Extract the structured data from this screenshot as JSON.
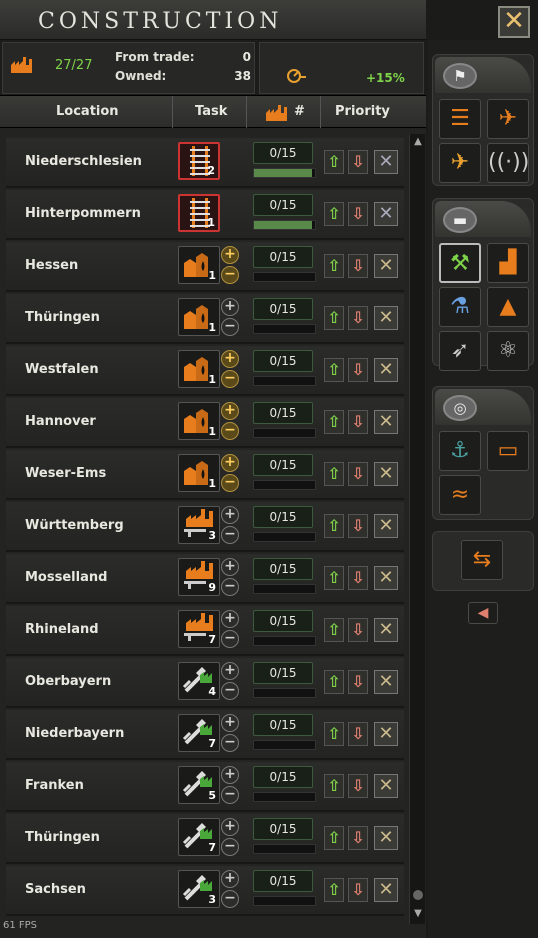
{
  "window": {
    "title": "Construction",
    "close_icon": "close-icon"
  },
  "stats": {
    "factories": "27/27",
    "from_trade_label": "From trade:",
    "from_trade_value": "0",
    "owned_label": "Owned:",
    "owned_value": "38",
    "efficiency": "+15%"
  },
  "columns": {
    "location": "Location",
    "task": "Task",
    "count": "#",
    "priority": "Priority"
  },
  "rows": [
    {
      "name": "Niederschlesien",
      "task": "railway",
      "count": "2",
      "progress": "0/15",
      "fill": 0.95,
      "enabled": true
    },
    {
      "name": "Hinterpommern",
      "task": "railway",
      "count": "1",
      "progress": "0/15",
      "fill": 0.95,
      "enabled": true
    },
    {
      "name": "Hessen",
      "task": "refinery",
      "count": "1",
      "progress": "0/15",
      "fill": 0,
      "enabled": true
    },
    {
      "name": "Thüringen",
      "task": "refinery",
      "count": "1",
      "progress": "0/15",
      "fill": 0,
      "enabled": false
    },
    {
      "name": "Westfalen",
      "task": "refinery",
      "count": "1",
      "progress": "0/15",
      "fill": 0,
      "enabled": true
    },
    {
      "name": "Hannover",
      "task": "refinery",
      "count": "1",
      "progress": "0/15",
      "fill": 0,
      "enabled": true
    },
    {
      "name": "Weser-Ems",
      "task": "refinery",
      "count": "1",
      "progress": "0/15",
      "fill": 0,
      "enabled": true
    },
    {
      "name": "Württemberg",
      "task": "civilian-factory",
      "count": "3",
      "progress": "0/15",
      "fill": 0,
      "enabled": false
    },
    {
      "name": "Mosselland",
      "task": "civilian-factory",
      "count": "9",
      "progress": "0/15",
      "fill": 0,
      "enabled": false
    },
    {
      "name": "Rhineland",
      "task": "civilian-factory",
      "count": "7",
      "progress": "0/15",
      "fill": 0,
      "enabled": false
    },
    {
      "name": "Oberbayern",
      "task": "military-factory",
      "count": "4",
      "progress": "0/15",
      "fill": 0,
      "enabled": false
    },
    {
      "name": "Niederbayern",
      "task": "military-factory",
      "count": "7",
      "progress": "0/15",
      "fill": 0,
      "enabled": false
    },
    {
      "name": "Franken",
      "task": "military-factory",
      "count": "5",
      "progress": "0/15",
      "fill": 0,
      "enabled": false
    },
    {
      "name": "Thüringen",
      "task": "military-factory",
      "count": "7",
      "progress": "0/15",
      "fill": 0,
      "enabled": false
    },
    {
      "name": "Sachsen",
      "task": "military-factory",
      "count": "3",
      "progress": "0/15",
      "fill": 0,
      "enabled": false
    }
  ],
  "sidebar": {
    "groups": [
      {
        "name": "infrastructure",
        "icon": "flag-icon",
        "buttons": [
          "railway-icon",
          "airfield-icon",
          "air-base-icon",
          "radar-icon"
        ]
      },
      {
        "name": "industry",
        "icon": "tank-icon",
        "buttons": [
          "military-factory-icon",
          "civilian-factory-icon",
          "synthetic-refinery-icon",
          "refinery-icon",
          "rocket-site-icon",
          "nuclear-reactor-icon"
        ]
      },
      {
        "name": "naval",
        "icon": "compass-icon",
        "buttons": [
          "naval-base-icon",
          "bunker-icon",
          "coastal-fort-icon"
        ]
      },
      {
        "name": "trade",
        "icon": "trade-icon",
        "buttons": [
          "trade-icon"
        ]
      }
    ],
    "collapse_icon": "arrow-left-icon"
  },
  "footer": {
    "fps": "61 FPS"
  },
  "colors": {
    "accent_green": "#7fd34a",
    "accent_red": "#e07f70",
    "selected_border": "#c33"
  }
}
